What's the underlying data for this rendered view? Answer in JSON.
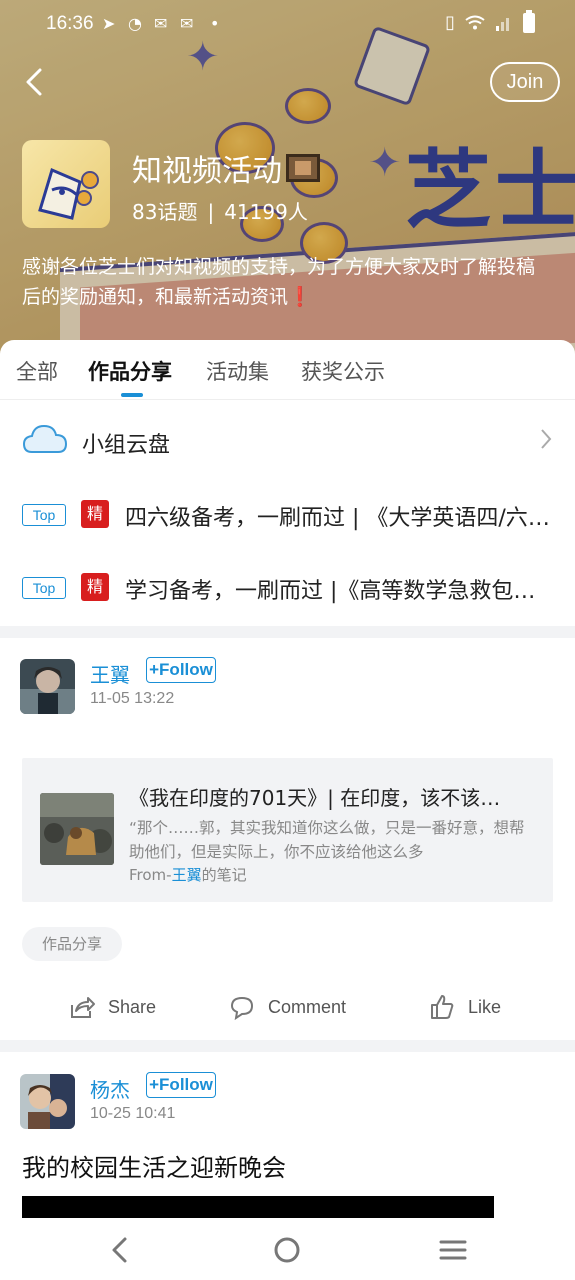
{
  "status_bar": {
    "time": "16:36",
    "left_icons": [
      "telegram-icon",
      "speed-icon",
      "mail-icon",
      "mail-icon",
      "dot-icon"
    ],
    "right_icons": [
      "vibrate-icon",
      "wifi-icon",
      "signal-icon",
      "battery-icon"
    ]
  },
  "header": {
    "join_label": "Join",
    "group_name": "知视频活动",
    "topics_count": "83话题",
    "separator": "|",
    "members_count": "41199人",
    "description": "感谢各位芝士们对知视频的支持，为了方便大家及时了解投稿后的奖励通知，和最新活动资讯",
    "description_mark": "❗",
    "banner_text": "芝士"
  },
  "tabs": [
    {
      "label": "全部"
    },
    {
      "label": "作品分享"
    },
    {
      "label": "活动集"
    },
    {
      "label": "获奖公示"
    }
  ],
  "active_tab": "作品分享",
  "cloud": {
    "label": "小组云盘"
  },
  "pinned": [
    {
      "top_tag": "Top",
      "essence_tag": "精",
      "title": "四六级备考，一刷而过 | 《大学英语四/六级…"
    },
    {
      "top_tag": "Top",
      "essence_tag": "精",
      "title": "学习备考，一刷而过 |《高等数学急救包…"
    }
  ],
  "posts": [
    {
      "author": "王翼",
      "follow_label": "+Follow",
      "time": "11-05 13:22",
      "card": {
        "title": "《我在印度的701天》|  在印度，该不该…",
        "quote": "“那个……郭，其实我知道你这么做，只是一番好意，想帮助他们，但是实际上，你不应该给他这么多",
        "from_prefix": "From-",
        "from_author": "王翼",
        "from_suffix": "的笔记"
      },
      "topic_chip": "作品分享",
      "actions": {
        "share": "Share",
        "comment": "Comment",
        "like": "Like"
      }
    },
    {
      "author": "杨杰",
      "follow_label": "+Follow",
      "time": "10-25 10:41",
      "title": "我的校园生活之迎新晚会"
    }
  ],
  "colors": {
    "accent": "#1a8fd6",
    "essence_red": "#d81e1e",
    "divider": "#f2f3f5"
  }
}
